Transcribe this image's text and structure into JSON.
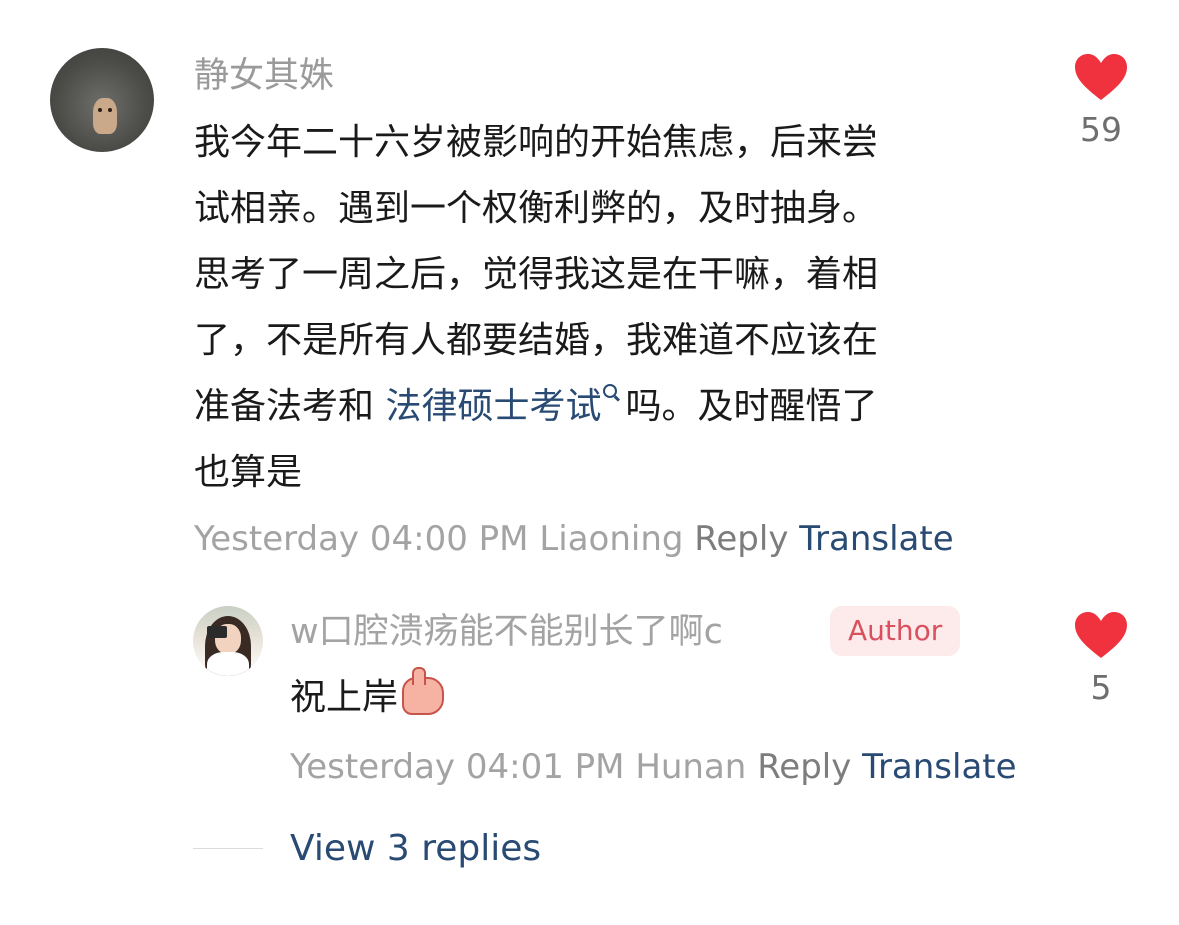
{
  "comment": {
    "username": "静女其姝",
    "text_lines": [
      "我今年二十六岁被影响的开始焦虑，后来尝",
      "试相亲。遇到一个权衡利弊的，及时抽身。",
      "思考了一周之后，觉得我这是在干嘛，着相",
      "了，不是所有人都要结婚，我难道不应该在"
    ],
    "line5_before": "准备法考和 ",
    "line5_link": "法律硕士考试",
    "line5_after": "吗。及时醒悟了",
    "line6": "也算是",
    "meta": {
      "time": "Yesterday 04:00 PM",
      "location": "Liaoning",
      "reply_label": "Reply",
      "translate_label": "Translate"
    },
    "likes": "59"
  },
  "reply": {
    "username": "w口腔溃疡能不能别长了啊c",
    "badge": "Author",
    "text": "祝上岸",
    "meta": {
      "time": "Yesterday 04:01 PM",
      "location": "Hunan",
      "reply_label": "Reply",
      "translate_label": "Translate"
    },
    "likes": "5"
  },
  "view_replies": "View 3 replies",
  "icons": {
    "like": "heart-icon",
    "search": "search-icon",
    "emoji": "thumbs-up-emoji"
  },
  "colors": {
    "heart": "#f0323f",
    "link": "#284a73",
    "badge_text": "#d9515f",
    "badge_bg": "#fdeaea"
  }
}
